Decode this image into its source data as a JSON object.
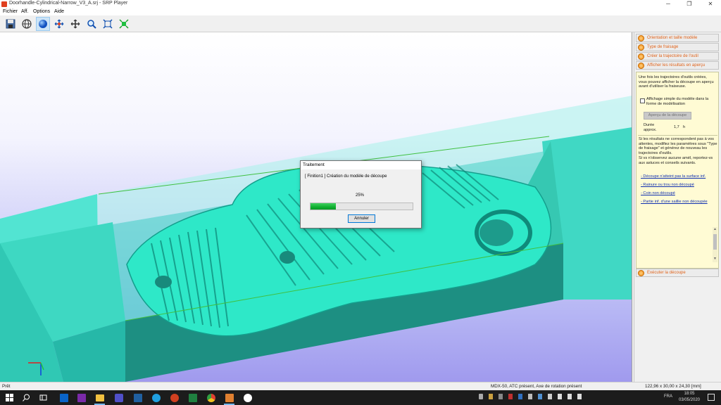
{
  "window": {
    "title": "Doorhandle-Cylindrical-Narrow_V3_A.srj - SRP Player",
    "minimize": "─",
    "maximize": "❐",
    "close": "✕"
  },
  "menu": {
    "items": [
      "Fichier",
      "Aff.",
      "Options",
      "Aide"
    ]
  },
  "toolbar": {
    "tools": [
      "save-icon",
      "globe-icon",
      "shaded-sphere-icon",
      "pan-icon",
      "move-icon",
      "zoom-icon",
      "fit-view-icon",
      "select-all-icon"
    ],
    "active_tool": "shaded-sphere-icon"
  },
  "steps": [
    {
      "label": "Orientation et taille modèle"
    },
    {
      "label": "Type de fraisage"
    },
    {
      "label": "Créer la trajectoire de l'outil"
    },
    {
      "label": "Afficher les résultats en aperçu"
    }
  ],
  "panel": {
    "intro": "Une fois les trajectoires d'outils créées, vous pouvez afficher la découpe en aperçu avant d'utiliser la fraiseuse.",
    "checkbox_label": "Affichage simple du modèle dans la forme de modélisation",
    "checkbox_checked": false,
    "preview_button": "Aperçu de la découpe",
    "duration_label": "Durée approx.",
    "duration_value": "1,7",
    "duration_unit": "h",
    "advice": "Si les résultats ne correspondent pas à vos attentes, modifiez les paramètres sous \"Type de fraisage\" et générez de nouveau les trajectoires d'outils.",
    "advice2": "Si vs n'observez aucune amél, reportez-vs aux astuces et conseils suivants.",
    "links": [
      "- Découpe n'atteint pas la surface inf.",
      "- Rainure ou trou non découpé",
      "- Coin non découpé",
      "- Partie inf. d'une saillie non découpée"
    ]
  },
  "execute_step": {
    "label": "Exécuter la découpe"
  },
  "dialog": {
    "title": "Traitement",
    "message": "[ Finition1 ]  Création du modèle de découpe",
    "percent_text": "25%",
    "progress": 0.25,
    "cancel": "Annuler"
  },
  "status": {
    "left": "Prêt",
    "machine": "MDX-50, ATC présent, Axe de rotation présent",
    "dimensions": "122,96 x 30,00 x 24,30 [mm]"
  },
  "taskbar": {
    "apps": [
      "outlook-icon",
      "onenote-icon",
      "file-explorer-icon",
      "teams-icon",
      "excel-x-icon",
      "skype-icon",
      "powerpoint-icon",
      "excel-icon",
      "chrome-icon",
      "srp-player-icon",
      "modela-icon"
    ],
    "language": "FRA",
    "time": "18:05",
    "date": "03/05/2020"
  },
  "colors": {
    "model": "#2ee8c8",
    "stock": "#7ef0e0",
    "step_text": "#e0641c",
    "panel_bg": "#fffbd4",
    "progress": "#10b030"
  }
}
